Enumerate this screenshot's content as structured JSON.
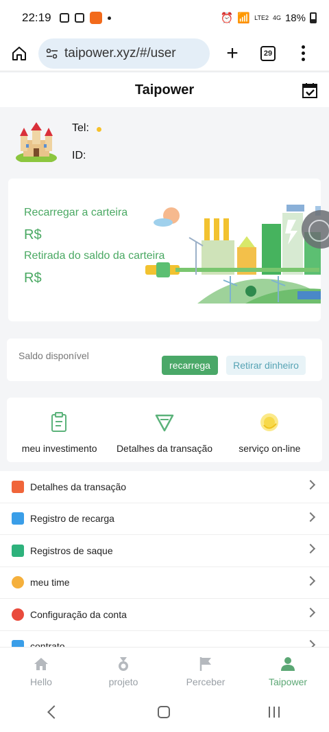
{
  "status_bar": {
    "time": "22:19",
    "network": "LTE2",
    "signal": "4G",
    "battery": "18%"
  },
  "browser": {
    "url": "taipower.xyz/#/user",
    "tab_count": "29"
  },
  "page": {
    "title": "Taipower"
  },
  "profile": {
    "tel_label": "Tel:",
    "id_label": "ID:"
  },
  "banner": {
    "recharge_label": "Recarregar a carteira",
    "recharge_value": "R$",
    "withdraw_label": "Retirada do saldo da carteira",
    "withdraw_value": "R$"
  },
  "balance": {
    "label": "Saldo disponível",
    "recharge_button": "recarrega",
    "withdraw_button": "Retirar dinheiro"
  },
  "shortcuts": [
    {
      "label": "meu investimento",
      "icon": "clipboard-icon"
    },
    {
      "label": "Detalhes da transação",
      "icon": "triangle-icon"
    },
    {
      "label": "serviço on-line",
      "icon": "support-icon"
    }
  ],
  "menu": [
    {
      "label": "Detalhes da transação",
      "icon": "wallet-icon",
      "color": "#f0653a"
    },
    {
      "label": "Registro de recarga",
      "icon": "recharge-icon",
      "color": "#3a9ee8"
    },
    {
      "label": "Registros de saque",
      "icon": "withdraw-icon",
      "color": "#2eb27c"
    },
    {
      "label": "meu time",
      "icon": "team-icon",
      "color": "#f5b03c"
    },
    {
      "label": "Configuração da conta",
      "icon": "settings-icon",
      "color": "#e94b3c"
    },
    {
      "label": "contrato",
      "icon": "contract-icon",
      "color": "#3a9ee8"
    }
  ],
  "tabbar": [
    {
      "label": "Hello",
      "icon": "home-icon",
      "active": false
    },
    {
      "label": "projeto",
      "icon": "medal-icon",
      "active": false
    },
    {
      "label": "Perceber",
      "icon": "flag-icon",
      "active": false
    },
    {
      "label": "Taipower",
      "icon": "user-icon",
      "active": true
    }
  ],
  "colors": {
    "accent_green": "#4aa868",
    "inactive_gray": "#9aa0a6"
  }
}
